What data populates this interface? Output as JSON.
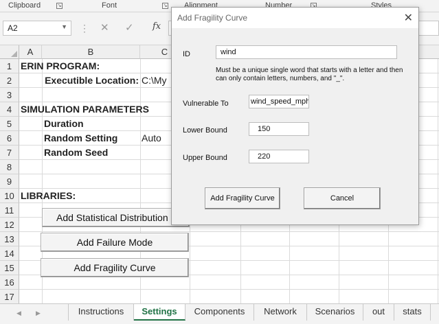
{
  "ribbon": {
    "groups": [
      "Clipboard",
      "Font",
      "Alignment",
      "Number",
      "Styles"
    ]
  },
  "formula_bar": {
    "name_box": "A2",
    "fx_label": "fx",
    "formula": ""
  },
  "grid": {
    "columns": [
      "A",
      "B",
      "C"
    ],
    "rows": [
      "1",
      "2",
      "3",
      "4",
      "5",
      "6",
      "7",
      "8",
      "9",
      "10",
      "11",
      "12",
      "13",
      "14",
      "15",
      "16",
      "17"
    ],
    "cells": {
      "a1": "ERIN PROGRAM:",
      "b2": "Executible Location:",
      "c2": "C:\\My",
      "a4": "SIMULATION PARAMETERS",
      "b5": "Duration",
      "b6": "Random Setting",
      "c6": "Auto",
      "b7": "Random Seed",
      "a10": "LIBRARIES:"
    },
    "buttons": {
      "add_statistical_distribution": "Add Statistical Distribution",
      "add_failure_mode": "Add Failure Mode",
      "add_fragility_curve": "Add Fragility Curve"
    }
  },
  "tabs": {
    "items": [
      "Instructions",
      "Settings",
      "Components",
      "Network",
      "Scenarios",
      "out",
      "stats"
    ],
    "active": "Settings"
  },
  "dialog": {
    "title": "Add Fragility Curve",
    "close_glyph": "✕",
    "id_label": "ID",
    "id_value": "wind",
    "hint": "Must be a unique single word that starts with a letter and then can only contain letters, numbers, and \"_\".",
    "vulnerable_to_label": "Vulnerable To",
    "vulnerable_to_value": "wind_speed_mph",
    "lower_bound_label": "Lower Bound",
    "lower_bound_value": "150",
    "upper_bound_label": "Upper Bound",
    "upper_bound_value": "220",
    "add_button": "Add Fragility Curve",
    "cancel_button": "Cancel"
  }
}
